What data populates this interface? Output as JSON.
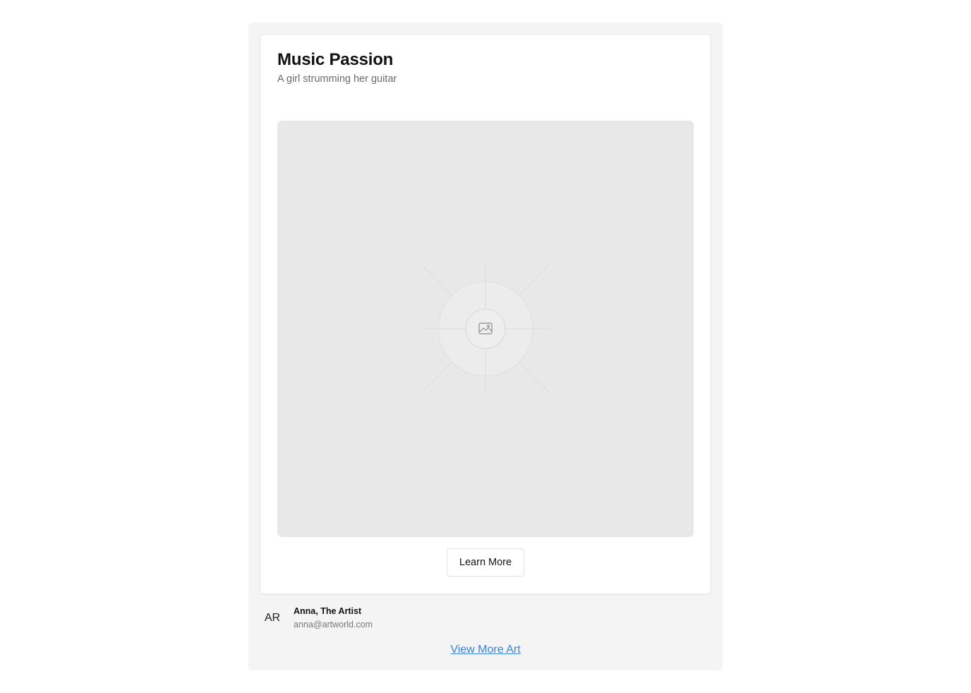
{
  "card": {
    "title": "Music Passion",
    "subtitle": "A girl strumming her guitar",
    "image_placeholder_icon": "image-icon",
    "learn_more_label": "Learn More"
  },
  "author": {
    "initials": "AR",
    "name": "Anna, The Artist",
    "email": "anna@artworld.com"
  },
  "footer": {
    "view_more_label": "View More Art"
  },
  "colors": {
    "link": "#3b82d6",
    "panel_background": "#f4f4f4",
    "image_placeholder_background": "#e8e8e8"
  }
}
